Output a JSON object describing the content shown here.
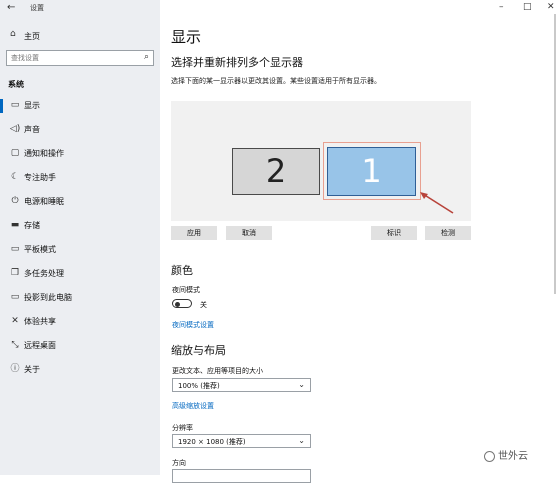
{
  "window": {
    "app_title": "设置",
    "minimize": "–",
    "maximize": "□",
    "close": "✕"
  },
  "sidebar": {
    "back_icon": "←",
    "home": {
      "label": "主页",
      "icon": "⌂"
    },
    "search": {
      "placeholder": "查找设置",
      "icon": "⌕"
    },
    "section_title": "系统",
    "items": [
      {
        "label": "显示",
        "icon": "▭",
        "selected": true
      },
      {
        "label": "声音",
        "icon": "◁)"
      },
      {
        "label": "通知和操作",
        "icon": "▢"
      },
      {
        "label": "专注助手",
        "icon": "☾"
      },
      {
        "label": "电源和睡眠",
        "icon": "⏻"
      },
      {
        "label": "存储",
        "icon": "▬"
      },
      {
        "label": "平板模式",
        "icon": "▭"
      },
      {
        "label": "多任务处理",
        "icon": "❐"
      },
      {
        "label": "投影到此电脑",
        "icon": "▭"
      },
      {
        "label": "体验共享",
        "icon": "✕"
      },
      {
        "label": "远程桌面",
        "icon": "⤡"
      },
      {
        "label": "关于",
        "icon": "ⓘ"
      }
    ]
  },
  "main": {
    "title": "显示",
    "arrange_heading": "选择并重新排列多个显示器",
    "arrange_desc": "选择下面的某一显示器以更改其设置。某些设置适用于所有显示器。",
    "monitors": {
      "left_label": "2",
      "right_label": "1"
    },
    "buttons": {
      "apply": "应用",
      "cancel": "取消",
      "identify": "标识",
      "detect": "检测"
    },
    "color_heading": "颜色",
    "night_light": {
      "label": "夜间模式",
      "state": "关",
      "settings_link": "夜间模式设置"
    },
    "scale_heading": "缩放与布局",
    "scale": {
      "label": "更改文本、应用等项目的大小",
      "value": "100% (推荐)",
      "advanced_link": "高级缩放设置"
    },
    "resolution": {
      "label": "分辨率",
      "value": "1920 × 1080 (推荐)"
    },
    "orientation": {
      "label": "方向"
    }
  },
  "watermark": "世外云"
}
